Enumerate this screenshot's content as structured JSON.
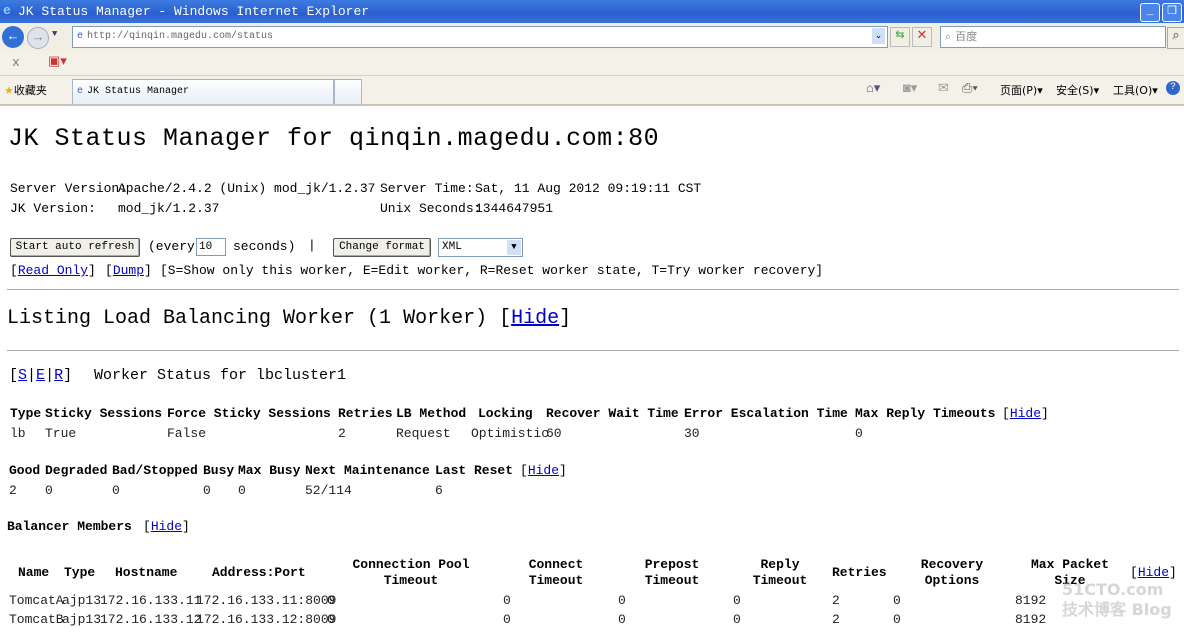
{
  "browser": {
    "window_title": "JK Status Manager - Windows Internet Explorer",
    "url": "http://qinqin.magedu.com/status",
    "search_placeholder": "百度",
    "favorites": "收藏夹",
    "tab_title": "JK Status Manager",
    "menu_page": "页面(P)",
    "menu_safety": "安全(S)",
    "menu_tools": "工具(O)",
    "close_glyph": "x"
  },
  "page": {
    "title": "JK Status Manager for qinqin.magedu.com:80",
    "server_version_label": "Server Version:",
    "server_version": "Apache/2.4.2 (Unix) mod_jk/1.2.37",
    "jk_version_label": "JK Version:",
    "jk_version": "mod_jk/1.2.37",
    "server_time_label": "Server Time:",
    "server_time": "Sat, 11 Aug 2012 09:19:11 CST",
    "unix_seconds_label": "Unix Seconds:",
    "unix_seconds": "1344647951",
    "start_refresh": "Start auto refresh",
    "every": "(every",
    "refresh_value": "10",
    "seconds": "seconds)",
    "pipe": "|",
    "change_format": "Change format",
    "format": "XML",
    "read_only": "Read Only",
    "dump": "Dump",
    "legend": "[S=Show only this worker, E=Edit worker, R=Reset worker state, T=Try worker recovery]",
    "section_title": "Listing Load Balancing Worker (1 Worker)",
    "hide": "Hide",
    "worker_actions": [
      "S",
      "E",
      "R"
    ],
    "worker_status": "Worker Status for lbcluster1",
    "lb_table": {
      "headers": [
        "Type",
        "Sticky Sessions",
        "Force Sticky Sessions",
        "Retries",
        "LB Method",
        "Locking",
        "Recover Wait Time",
        "Error Escalation Time",
        "Max Reply Timeouts"
      ],
      "values": [
        "lb",
        "True",
        "False",
        "2",
        "Request",
        "Optimistic",
        "60",
        "30",
        "0"
      ]
    },
    "state_table": {
      "headers": [
        "Good",
        "Degraded",
        "Bad/Stopped",
        "Busy",
        "Max Busy",
        "Next Maintenance",
        "Last Reset"
      ],
      "values": [
        "2",
        "0",
        "0",
        "0",
        "0",
        "52/114",
        "6"
      ]
    },
    "balancer_members": "Balancer Members",
    "members_table": {
      "headers": [
        "Name",
        "Type",
        "Hostname",
        "Address:Port",
        "Connection Pool Timeout",
        "Connect Timeout",
        "Prepost Timeout",
        "Reply Timeout",
        "Retries",
        "Recovery Options",
        "Max Packet Size"
      ],
      "rows": [
        [
          "TomcatA",
          "ajp13",
          "172.16.133.11",
          "172.16.133.11:8009",
          "0",
          "0",
          "0",
          "0",
          "2",
          "0",
          "8192"
        ],
        [
          "TomcatB",
          "ajp13",
          "172.16.133.12",
          "172.16.133.12:8009",
          "0",
          "0",
          "0",
          "0",
          "2",
          "0",
          "8192"
        ]
      ]
    },
    "watermark": "51CTO.com 技术博客 Blog"
  }
}
